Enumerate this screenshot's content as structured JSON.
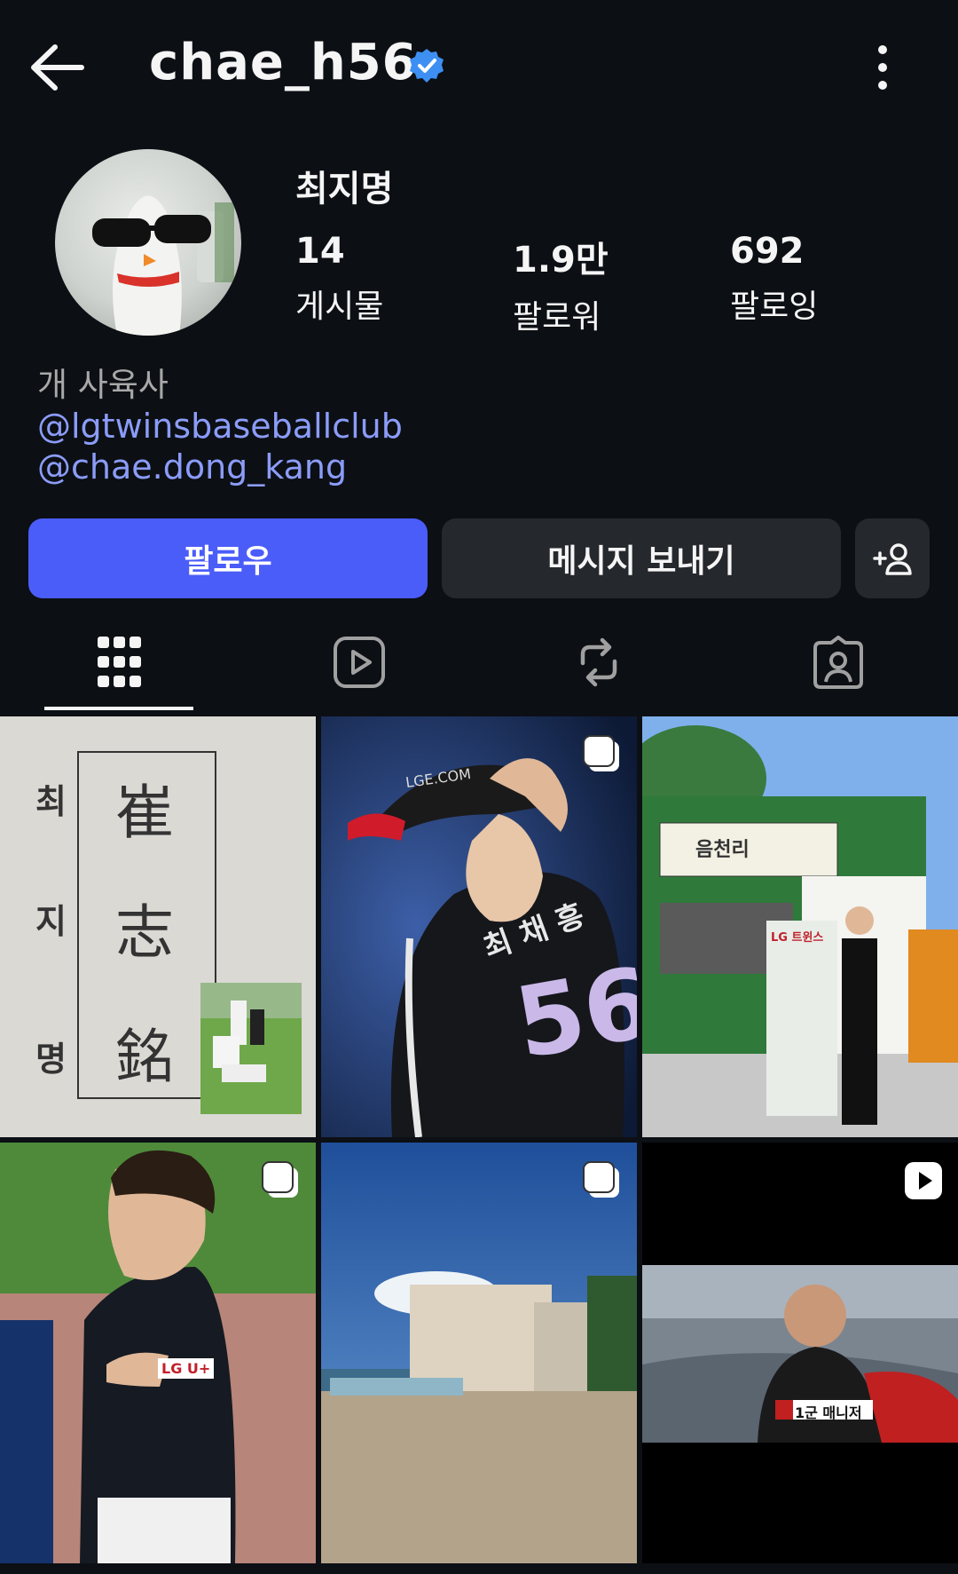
{
  "header": {
    "username": "chae_h56",
    "back_icon": "arrow-left-icon",
    "verified_icon": "verified-badge-icon",
    "more_icon": "more-vertical-icon"
  },
  "profile": {
    "display_name": "최지명",
    "stats": [
      {
        "value": "14",
        "label": "게시물"
      },
      {
        "value": "1.9만",
        "label": "팔로워"
      },
      {
        "value": "692",
        "label": "팔로잉"
      }
    ],
    "category": "개 사육사",
    "links": [
      "@lgtwinsbaseballclub",
      "@chae.dong_kang"
    ]
  },
  "actions": {
    "follow_label": "팔로우",
    "message_label": "메시지 보내기",
    "add_person_icon": "add-person-icon"
  },
  "tabs": [
    {
      "name": "grid-icon",
      "active": true
    },
    {
      "name": "reels-icon",
      "active": false
    },
    {
      "name": "reposts-icon",
      "active": false
    },
    {
      "name": "tagged-icon",
      "active": false
    }
  ],
  "posts": [
    {
      "type": "photo",
      "text": [
        "최",
        "지",
        "명",
        "崔",
        "志",
        "銘"
      ]
    },
    {
      "type": "carousel",
      "text": [
        "LGE.COM",
        "최 채 흥",
        "56"
      ]
    },
    {
      "type": "carousel",
      "text": [
        "음천리",
        "LG 트윈스"
      ]
    },
    {
      "type": "carousel",
      "text": [
        "LG U+"
      ]
    },
    {
      "type": "carousel",
      "text": []
    },
    {
      "type": "reel",
      "text": [
        "1군 매니저"
      ]
    }
  ],
  "colors": {
    "background": "#0c0f14",
    "follow_button": "#4a5df9",
    "secondary_button": "#25282d",
    "link": "#8b9cf8",
    "verified": "#3d8ff2"
  }
}
